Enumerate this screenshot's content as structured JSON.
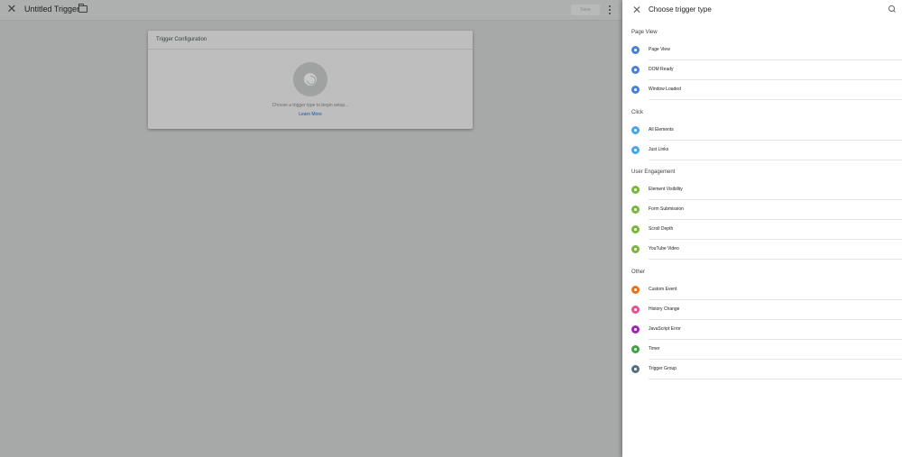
{
  "header": {
    "title": "Untitled Trigger",
    "save_label": "Save"
  },
  "card": {
    "title": "Trigger Configuration",
    "hint": "Choose a trigger type to begin setup...",
    "learn_more": "Learn More"
  },
  "panel": {
    "title": "Choose trigger type",
    "groups": [
      {
        "title": "Page View",
        "items": [
          {
            "label": "Page View",
            "icon": "eye-icon",
            "color": "#4a7fd8"
          },
          {
            "label": "DOM Ready",
            "icon": "document-icon",
            "color": "#4a7fd8"
          },
          {
            "label": "Window Loaded",
            "icon": "window-icon",
            "color": "#4a7fd8"
          }
        ]
      },
      {
        "title": "Click",
        "items": [
          {
            "label": "All Elements",
            "icon": "mouse-icon",
            "color": "#4ba3e3"
          },
          {
            "label": "Just Links",
            "icon": "link-icon",
            "color": "#4ba3e3"
          }
        ]
      },
      {
        "title": "User Engagement",
        "items": [
          {
            "label": "Element Visibility",
            "icon": "visibility-icon",
            "color": "#7cb342"
          },
          {
            "label": "Form Submission",
            "icon": "form-icon",
            "color": "#7cb342"
          },
          {
            "label": "Scroll Depth",
            "icon": "scroll-icon",
            "color": "#7cb342"
          },
          {
            "label": "YouTube Video",
            "icon": "play-icon",
            "color": "#7cb342"
          }
        ]
      },
      {
        "title": "Other",
        "items": [
          {
            "label": "Custom Event",
            "icon": "code-icon",
            "color": "#e8711a"
          },
          {
            "label": "History Change",
            "icon": "history-icon",
            "color": "#e0548e"
          },
          {
            "label": "JavaScript Error",
            "icon": "warning-icon",
            "color": "#9c27b0"
          },
          {
            "label": "Timer",
            "icon": "timer-icon",
            "color": "#43a047"
          },
          {
            "label": "Trigger Group",
            "icon": "group-icon",
            "color": "#546e7a"
          }
        ]
      }
    ]
  }
}
